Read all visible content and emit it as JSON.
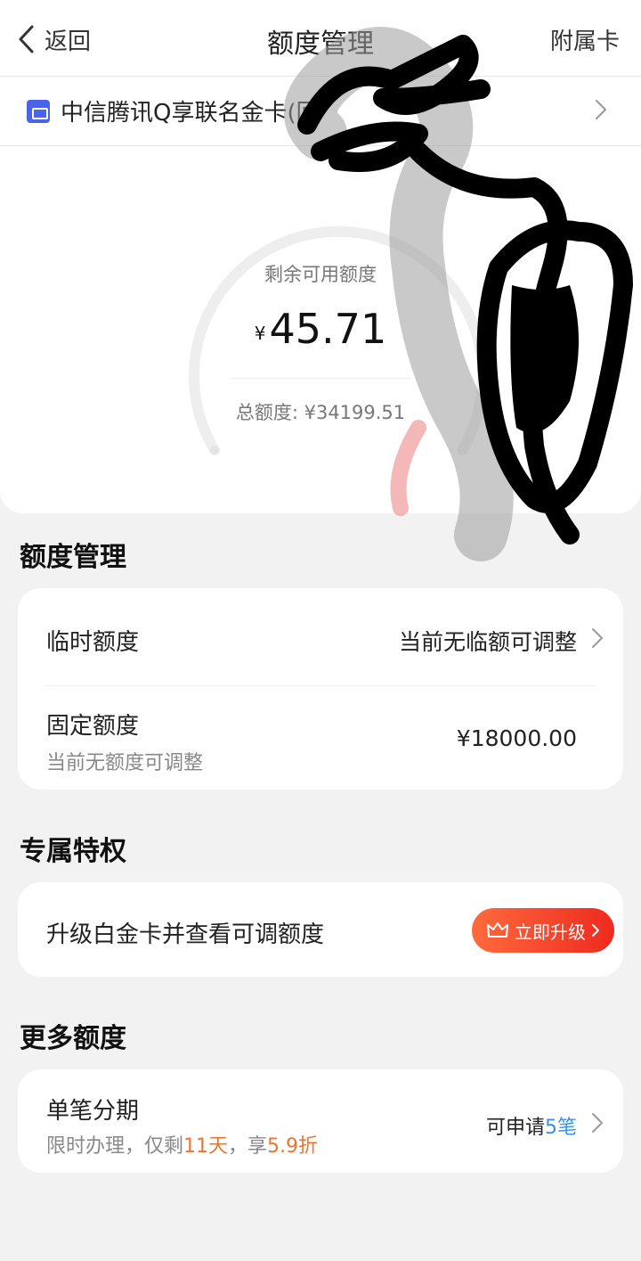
{
  "nav": {
    "back_label": "返回",
    "title": "额度管理",
    "right_label": "附属卡"
  },
  "card": {
    "name": "中信腾讯Q享联名金卡(回"
  },
  "gauge": {
    "label": "剩余可用额度",
    "currency": "¥",
    "available": "45.71",
    "total_text": "总额度: ¥34199.51",
    "available_fraction": 0.0013
  },
  "limit_section": {
    "title": "额度管理",
    "temporary": {
      "label": "临时额度",
      "value": "当前无临额可调整"
    },
    "fixed": {
      "label": "固定额度",
      "sub": "当前无额度可调整",
      "value": "¥18000.00"
    }
  },
  "privilege_section": {
    "title": "专属特权",
    "upgrade": {
      "label": "升级白金卡并查看可调额度",
      "button": "立即升级"
    }
  },
  "more_section": {
    "title": "更多额度",
    "installment": {
      "label": "单笔分期",
      "sub_prefix": "限时办理，仅剩",
      "sub_days": "11天",
      "sub_mid": "，享",
      "sub_discount": "5.9折",
      "avail_prefix": "可申请",
      "avail_count": "5笔"
    }
  },
  "colors": {
    "accent_card": "#4a63e8",
    "button_start": "#ff6a3d",
    "button_end": "#ee2a1e",
    "highlight_orange": "#e8762d",
    "highlight_blue": "#3a8fe6"
  }
}
